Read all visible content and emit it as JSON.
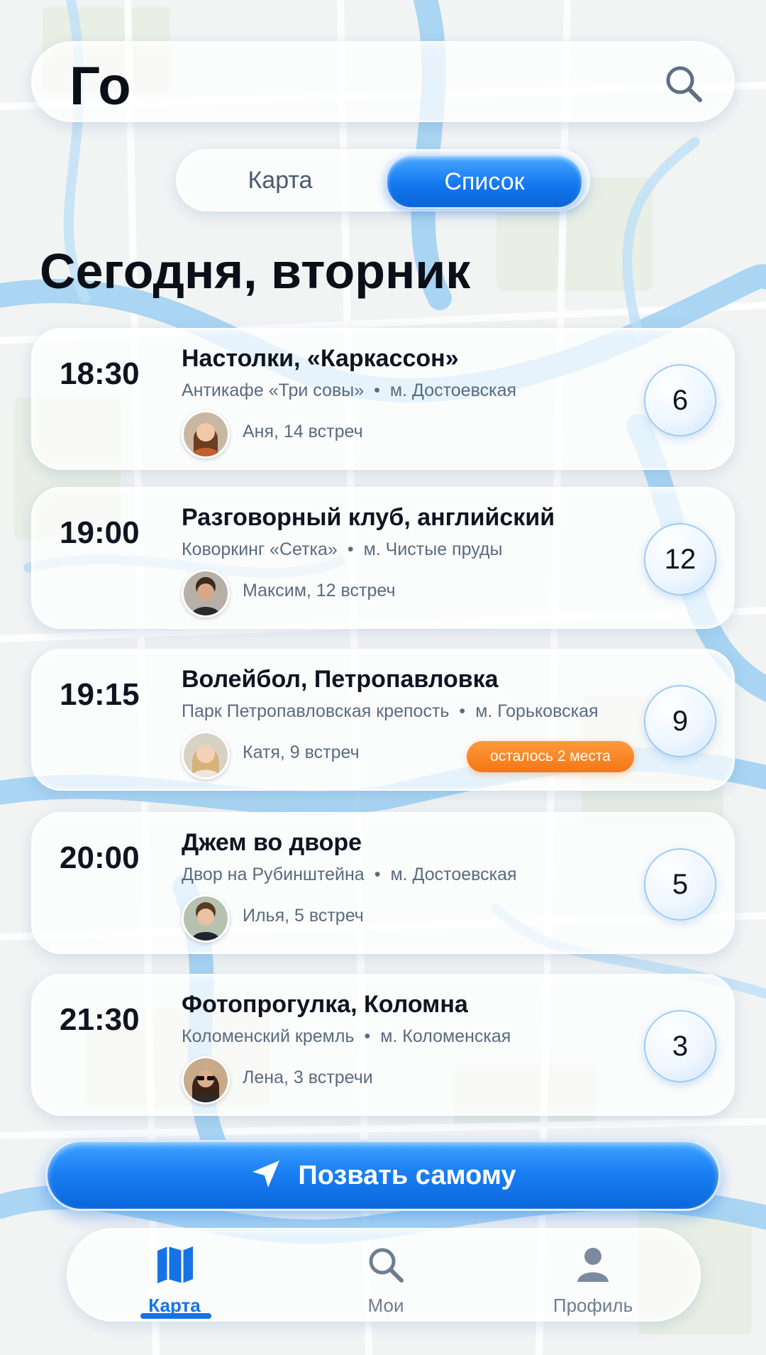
{
  "header": {
    "app_title": "Го",
    "search_icon": "search-icon"
  },
  "view_toggle": {
    "options": [
      "Карта",
      "Список"
    ],
    "selected": "Список"
  },
  "day_heading": "Сегодня, вторник",
  "events": [
    {
      "time": "18:30",
      "title": "Настолки, «Каркассон»",
      "place": "Антикафе «Три совы»",
      "metro": "м. Достоевская",
      "host": "Аня, 14 встреч",
      "count": "6",
      "badge": ""
    },
    {
      "time": "19:00",
      "title": "Разговорный клуб, английский",
      "place": "Коворкинг «Сетка»",
      "metro": "м. Чистые пруды",
      "host": "Максим, 12 встреч",
      "count": "12",
      "badge": ""
    },
    {
      "time": "19:15",
      "title": "Волейбол, Петропавловка",
      "place": "Парк Петропавловская крепость",
      "metro": "м. Горьковская",
      "host": "Катя, 9 встреч",
      "count": "9",
      "badge": "осталось 2 места"
    },
    {
      "time": "20:00",
      "title": "Джем во дворе",
      "place": "Двор на Рубинштейна",
      "metro": "м. Достоевская",
      "host": "Илья, 5 встреч",
      "count": "5",
      "badge": ""
    },
    {
      "time": "21:30",
      "title": "Фотопрогулка, Коломна",
      "place": "Коломенский кремль",
      "metro": "м. Коломенская",
      "host": "Лена, 3 встречи",
      "count": "3",
      "badge": ""
    }
  ],
  "separator": "•",
  "cta": {
    "label": "Позвать самому",
    "icon": "navigation-arrow-icon"
  },
  "bottom_nav": {
    "items": [
      {
        "label": "Карта",
        "icon": "map-icon",
        "active": true
      },
      {
        "label": "Мои",
        "icon": "search-icon",
        "active": false
      },
      {
        "label": "Профиль",
        "icon": "profile-icon",
        "active": false
      }
    ]
  },
  "colors": {
    "accent": "#1673e6",
    "badge": "#f57614",
    "text": "#0e1420",
    "muted": "#5a6b80"
  }
}
